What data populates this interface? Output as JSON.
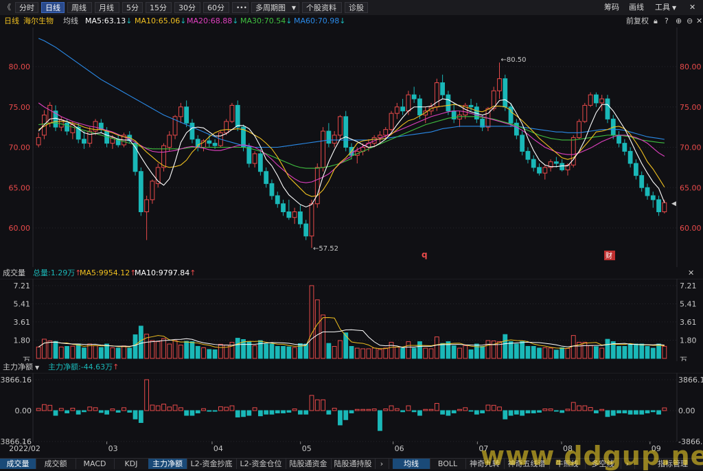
{
  "toolbar": {
    "back": "《",
    "periods": [
      "分时",
      "日线",
      "周线",
      "月线",
      "5分",
      "15分",
      "30分",
      "60分"
    ],
    "active_period": "日线",
    "more": "•••",
    "multi": "多周期图",
    "profile": "个股资料",
    "diagnose": "诊股",
    "chips": "筹码",
    "draw": "画线",
    "tools": "工具",
    "close": "✕"
  },
  "info": {
    "period": "日线",
    "stock": "海尔生物",
    "ma_label": "均线",
    "ma5": "MA5:63.13",
    "ma10": "MA10:65.06",
    "ma20": "MA20:68.88",
    "ma30": "MA30:70.54",
    "ma60": "MA60:70.98",
    "adjust": "前复权"
  },
  "colors": {
    "up": "#e84a4a",
    "down": "#1ab8b8",
    "ma5": "#ffffff",
    "ma10": "#f0c020",
    "ma20": "#e040c0",
    "ma30": "#40c040",
    "ma60": "#2a8ae8"
  },
  "price_axis": {
    "ticks": [
      "80.00",
      "75.00",
      "70.00",
      "65.00",
      "60.00"
    ]
  },
  "annotations": {
    "high": "80.50",
    "low": "57.52",
    "marker_q": "q",
    "marker_cai": "财"
  },
  "volume": {
    "title": "成交量",
    "total": "总量:1.29万",
    "ma5": "MA5:9954.12",
    "ma10": "MA10:9797.84",
    "ticks": [
      "7.21",
      "5.41",
      "3.61",
      "1.80",
      "万"
    ]
  },
  "fund": {
    "title": "主力净额",
    "value": "主力净额:-44.63万",
    "ticks": [
      "3866.16",
      "0.00",
      "-3866.16"
    ]
  },
  "date_axis": [
    "2022/02",
    "03",
    "04",
    "05",
    "06",
    "07",
    "08",
    "09"
  ],
  "bottom_tabs_left": [
    "成交量",
    "成交额",
    "MACD",
    "KDJ",
    "主力净额",
    "L2-资金抄底",
    "L2-资金仓位",
    "陆股通资金",
    "陆股通持股"
  ],
  "bottom_tabs_right": [
    "均线",
    "BOLL",
    "神奇九转",
    "神奇五线谱",
    "牛熊线",
    "多空线"
  ],
  "bottom_more": "指标管理",
  "watermark": "www.ddgup.net",
  "chart_data": {
    "type": "candlestick",
    "ylim": [
      56,
      84
    ],
    "candles": [
      [
        70.3,
        71.8,
        70.0,
        71.2
      ],
      [
        71.5,
        74.6,
        71.0,
        74.0
      ],
      [
        73.0,
        75.6,
        72.5,
        75.2
      ],
      [
        74.5,
        75.2,
        72.0,
        72.5
      ],
      [
        72.5,
        73.8,
        72.0,
        73.4
      ],
      [
        73.0,
        73.5,
        71.5,
        72.0
      ],
      [
        71.8,
        73.2,
        71.0,
        72.8
      ],
      [
        72.5,
        73.0,
        70.5,
        71.0
      ],
      [
        71.0,
        72.0,
        69.8,
        70.5
      ],
      [
        70.5,
        72.5,
        70.0,
        72.0
      ],
      [
        72.0,
        73.5,
        71.5,
        73.2
      ],
      [
        73.0,
        73.5,
        71.8,
        72.2
      ],
      [
        72.0,
        72.5,
        70.0,
        70.5
      ],
      [
        70.5,
        71.5,
        69.8,
        71.2
      ],
      [
        71.0,
        71.5,
        70.0,
        70.3
      ],
      [
        70.3,
        71.8,
        70.0,
        71.5
      ],
      [
        71.5,
        72.0,
        70.5,
        70.8
      ],
      [
        70.5,
        70.8,
        66.5,
        67.0
      ],
      [
        67.0,
        67.5,
        61.5,
        62.0
      ],
      [
        62.0,
        64.0,
        58.5,
        63.5
      ],
      [
        63.5,
        66.0,
        63.0,
        65.8
      ],
      [
        65.5,
        68.0,
        65.0,
        67.5
      ],
      [
        67.5,
        70.5,
        67.0,
        70.2
      ],
      [
        70.0,
        72.0,
        69.5,
        71.5
      ],
      [
        71.5,
        74.0,
        71.0,
        73.8
      ],
      [
        73.8,
        75.5,
        73.0,
        75.0
      ],
      [
        75.0,
        75.8,
        72.5,
        73.0
      ],
      [
        73.0,
        73.5,
        70.5,
        71.0
      ],
      [
        71.0,
        71.5,
        69.5,
        70.0
      ],
      [
        70.0,
        71.0,
        69.5,
        70.8
      ],
      [
        70.8,
        71.5,
        70.0,
        70.5
      ],
      [
        70.5,
        71.0,
        69.8,
        70.2
      ],
      [
        70.2,
        72.0,
        70.0,
        71.8
      ],
      [
        71.8,
        73.5,
        71.5,
        73.2
      ],
      [
        73.2,
        75.5,
        73.0,
        75.2
      ],
      [
        75.2,
        75.8,
        72.0,
        72.5
      ],
      [
        72.5,
        72.8,
        69.5,
        70.0
      ],
      [
        70.0,
        70.5,
        67.5,
        68.0
      ],
      [
        68.0,
        69.5,
        67.5,
        69.2
      ],
      [
        69.2,
        69.8,
        66.5,
        67.0
      ],
      [
        67.0,
        67.5,
        65.0,
        65.5
      ],
      [
        65.5,
        66.0,
        63.5,
        64.0
      ],
      [
        64.0,
        64.5,
        62.5,
        63.0
      ],
      [
        63.0,
        63.5,
        61.5,
        62.0
      ],
      [
        62.0,
        63.5,
        61.0,
        61.3
      ],
      [
        61.3,
        62.5,
        60.5,
        62.0
      ],
      [
        62.0,
        62.8,
        60.0,
        60.5
      ],
      [
        60.5,
        61.0,
        58.5,
        59.0
      ],
      [
        59.0,
        63.5,
        57.52,
        63.0
      ],
      [
        63.0,
        68.0,
        62.5,
        67.5
      ],
      [
        67.5,
        72.5,
        67.0,
        72.0
      ],
      [
        72.0,
        73.0,
        70.0,
        70.5
      ],
      [
        70.5,
        72.0,
        70.0,
        71.5
      ],
      [
        71.5,
        74.0,
        71.0,
        73.8
      ],
      [
        73.8,
        74.5,
        69.5,
        70.0
      ],
      [
        70.0,
        70.5,
        68.5,
        69.0
      ],
      [
        69.0,
        70.0,
        68.0,
        69.5
      ],
      [
        69.5,
        70.5,
        69.0,
        70.0
      ],
      [
        70.0,
        71.0,
        69.5,
        70.5
      ],
      [
        70.5,
        71.5,
        70.0,
        71.2
      ],
      [
        71.2,
        72.0,
        70.5,
        71.5
      ],
      [
        71.5,
        72.5,
        71.0,
        72.2
      ],
      [
        72.2,
        74.5,
        72.0,
        74.2
      ],
      [
        74.2,
        75.5,
        73.5,
        75.0
      ],
      [
        75.0,
        76.0,
        74.0,
        74.5
      ],
      [
        74.5,
        77.0,
        74.0,
        76.5
      ],
      [
        76.5,
        77.5,
        75.5,
        76.0
      ],
      [
        76.0,
        76.5,
        73.5,
        74.0
      ],
      [
        74.0,
        75.0,
        73.0,
        74.5
      ],
      [
        74.5,
        75.5,
        74.0,
        75.0
      ],
      [
        75.0,
        78.5,
        74.5,
        78.0
      ],
      [
        78.0,
        79.0,
        76.0,
        76.5
      ],
      [
        76.5,
        77.0,
        74.0,
        74.5
      ],
      [
        74.5,
        75.5,
        73.0,
        73.5
      ],
      [
        73.5,
        74.5,
        72.5,
        74.0
      ],
      [
        74.0,
        75.5,
        73.5,
        75.2
      ],
      [
        75.2,
        76.0,
        74.5,
        75.0
      ],
      [
        75.0,
        75.5,
        73.0,
        73.5
      ],
      [
        73.5,
        74.0,
        72.0,
        72.5
      ],
      [
        72.5,
        75.0,
        72.0,
        74.8
      ],
      [
        74.8,
        77.5,
        74.5,
        77.0
      ],
      [
        77.0,
        80.5,
        76.0,
        78.5
      ],
      [
        78.5,
        79.0,
        74.5,
        75.0
      ],
      [
        75.0,
        75.5,
        72.5,
        73.0
      ],
      [
        73.0,
        73.5,
        71.0,
        71.5
      ],
      [
        71.5,
        72.0,
        69.0,
        69.5
      ],
      [
        69.5,
        70.0,
        68.0,
        68.5
      ],
      [
        68.5,
        69.0,
        67.0,
        67.5
      ],
      [
        67.5,
        68.0,
        66.5,
        66.8
      ],
      [
        66.8,
        67.8,
        66.0,
        67.5
      ],
      [
        67.5,
        68.5,
        67.0,
        68.2
      ],
      [
        68.2,
        68.8,
        67.5,
        68.0
      ],
      [
        68.0,
        68.5,
        67.0,
        67.2
      ],
      [
        67.2,
        68.0,
        66.5,
        67.8
      ],
      [
        67.8,
        71.5,
        67.5,
        71.2
      ],
      [
        71.2,
        73.5,
        71.0,
        73.2
      ],
      [
        73.2,
        75.5,
        73.0,
        75.2
      ],
      [
        75.2,
        76.8,
        75.0,
        76.5
      ],
      [
        76.5,
        76.8,
        75.0,
        75.5
      ],
      [
        75.5,
        76.5,
        74.5,
        76.0
      ],
      [
        76.0,
        76.5,
        73.0,
        73.5
      ],
      [
        73.5,
        74.0,
        71.0,
        71.5
      ],
      [
        71.5,
        72.0,
        70.0,
        70.5
      ],
      [
        70.5,
        71.0,
        69.0,
        69.5
      ],
      [
        69.5,
        70.0,
        67.5,
        68.0
      ],
      [
        68.0,
        68.5,
        66.0,
        66.5
      ],
      [
        66.5,
        67.0,
        64.5,
        65.0
      ],
      [
        65.0,
        65.5,
        63.5,
        64.0
      ],
      [
        64.0,
        64.5,
        62.5,
        63.5
      ],
      [
        63.5,
        64.0,
        61.5,
        62.0
      ],
      [
        62.0,
        63.5,
        61.8,
        63.13
      ]
    ],
    "ma_lines": {
      "ma5": [
        72.0,
        72.8,
        73.5,
        73.6,
        73.4,
        73.2,
        72.8,
        72.3,
        71.8,
        71.6,
        71.7,
        71.8,
        71.5,
        71.3,
        71.0,
        70.9,
        70.9,
        70.0,
        68.8,
        67.7,
        66.7,
        65.8,
        65.3,
        66.1,
        68.2,
        70.6,
        71.8,
        72.4,
        72.5,
        72.4,
        71.9,
        71.4,
        71.4,
        71.7,
        72.2,
        72.7,
        72.7,
        72.3,
        71.4,
        70.1,
        68.5,
        67.7,
        66.5,
        65.1,
        64.1,
        63.5,
        62.9,
        62.6,
        62.9,
        64.1,
        66.4,
        68.2,
        69.7,
        71.0,
        71.3,
        71.0,
        70.7,
        70.3,
        70.0,
        70.1,
        70.5,
        71.0,
        71.8,
        72.8,
        73.7,
        74.5,
        75.0,
        75.0,
        75.0,
        75.1,
        75.6,
        76.0,
        75.9,
        75.5,
        75.1,
        74.7,
        74.4,
        74.2,
        74.0,
        74.2,
        74.9,
        75.8,
        75.9,
        75.4,
        74.2,
        72.9,
        71.1,
        69.6,
        68.4,
        67.8,
        67.6,
        67.6,
        67.7,
        67.7,
        68.5,
        69.5,
        70.9,
        72.7,
        74.3,
        75.3,
        75.3,
        74.5,
        73.4,
        72.3,
        70.9,
        69.4,
        68.0,
        66.8,
        65.7,
        64.9,
        63.13
      ],
      "ma10": [
        72.2,
        72.6,
        73.0,
        73.2,
        73.2,
        73.2,
        73.0,
        72.8,
        72.5,
        72.3,
        72.2,
        72.2,
        72.0,
        71.8,
        71.5,
        71.3,
        71.2,
        70.8,
        70.1,
        69.4,
        68.8,
        68.2,
        67.7,
        67.5,
        67.6,
        67.8,
        68.4,
        69.4,
        70.1,
        70.3,
        70.6,
        71.3,
        71.8,
        72.1,
        72.2,
        72.2,
        72.3,
        72.2,
        71.9,
        71.5,
        71.1,
        70.5,
        69.8,
        68.8,
        67.6,
        66.3,
        65.6,
        64.9,
        64.2,
        63.9,
        64.0,
        64.7,
        65.8,
        67.3,
        68.1,
        68.7,
        69.5,
        70.5,
        70.8,
        70.9,
        71.0,
        71.0,
        71.1,
        71.6,
        72.2,
        72.8,
        73.3,
        73.5,
        73.9,
        74.3,
        74.8,
        75.0,
        75.1,
        75.2,
        75.3,
        75.2,
        75.0,
        74.8,
        74.5,
        74.4,
        74.7,
        75.1,
        75.1,
        75.0,
        74.6,
        74.4,
        73.9,
        73.3,
        72.6,
        71.9,
        71.1,
        70.5,
        69.9,
        69.3,
        68.7,
        68.5,
        68.7,
        69.4,
        70.2,
        71.0,
        71.9,
        72.0,
        72.2,
        72.5,
        72.6,
        72.3,
        71.6,
        70.6,
        69.5,
        68.2,
        67.3,
        66.2,
        65.06
      ],
      "ma20": [
        75.5,
        75.0,
        74.6,
        74.2,
        73.8,
        73.5,
        73.2,
        73.0,
        72.8,
        72.6,
        72.5,
        72.3,
        72.1,
        71.9,
        71.6,
        71.3,
        71.0,
        70.6,
        70.2,
        69.8,
        69.5,
        69.4,
        69.4,
        69.5,
        69.6,
        69.8,
        70.0,
        70.1,
        70.0,
        69.9,
        69.7,
        69.6,
        69.6,
        69.8,
        70.0,
        70.2,
        70.3,
        70.2,
        70.0,
        69.6,
        69.1,
        68.5,
        67.8,
        67.2,
        66.6,
        66.1,
        65.7,
        65.6,
        65.7,
        66.0,
        66.3,
        66.7,
        67.3,
        68.0,
        68.5,
        68.9,
        69.3,
        69.7,
        70.1,
        70.5,
        70.8,
        71.1,
        71.4,
        71.7,
        72.0,
        72.3,
        72.6,
        72.9,
        73.2,
        73.5,
        73.8,
        74.0,
        74.2,
        74.4,
        74.5,
        74.5,
        74.4,
        74.2,
        74.0,
        73.8,
        73.6,
        73.4,
        73.2,
        73.0,
        72.8,
        72.5,
        72.1,
        71.6,
        71.0,
        70.5,
        70.0,
        69.7,
        69.4,
        69.2,
        69.1,
        69.1,
        69.3,
        69.6,
        69.9,
        70.3,
        70.7,
        71.0,
        71.3,
        71.5,
        71.5,
        71.4,
        71.2,
        70.9,
        70.5,
        69.9,
        69.3,
        68.88
      ],
      "ma30": [
        72.8,
        72.9,
        73.0,
        73.0,
        72.9,
        72.7,
        72.5,
        72.3,
        72.1,
        71.9,
        71.7,
        71.5,
        71.3,
        71.1,
        70.9,
        70.7,
        70.5,
        70.3,
        70.1,
        69.9,
        69.8,
        69.8,
        69.8,
        69.8,
        69.8,
        69.8,
        69.9,
        70.0,
        70.0,
        70.0,
        70.0,
        70.0,
        70.0,
        70.0,
        70.0,
        70.0,
        70.0,
        69.9,
        69.7,
        69.5,
        69.2,
        68.9,
        68.6,
        68.3,
        68.0,
        67.7,
        67.5,
        67.4,
        67.4,
        67.4,
        67.5,
        67.6,
        67.8,
        68.0,
        68.3,
        68.6,
        68.9,
        69.2,
        69.5,
        69.8,
        70.1,
        70.4,
        70.7,
        71.0,
        71.3,
        71.6,
        71.9,
        72.2,
        72.5,
        72.8,
        73.0,
        73.2,
        73.4,
        73.6,
        73.7,
        73.8,
        73.8,
        73.8,
        73.8,
        73.7,
        73.6,
        73.5,
        73.3,
        73.1,
        72.9,
        72.7,
        72.4,
        72.1,
        71.8,
        71.5,
        71.3,
        71.1,
        71.0,
        70.9,
        70.9,
        70.9,
        71.0,
        71.1,
        71.2,
        71.3,
        71.4,
        71.5,
        71.5,
        71.5,
        71.4,
        71.3,
        71.1,
        70.9,
        70.8,
        70.7,
        70.6,
        70.54
      ],
      "ma60": [
        83.5,
        83.2,
        82.8,
        82.4,
        81.9,
        81.4,
        80.9,
        80.4,
        79.9,
        79.4,
        78.9,
        78.4,
        78.0,
        77.6,
        77.2,
        76.8,
        76.4,
        76.0,
        75.6,
        75.2,
        74.8,
        74.4,
        74.0,
        73.7,
        73.4,
        73.1,
        72.8,
        72.5,
        72.2,
        71.9,
        71.6,
        71.3,
        71.0,
        70.8,
        70.6,
        70.4,
        70.2,
        70.1,
        70.0,
        70.0,
        70.0,
        70.0,
        70.0,
        70.1,
        70.2,
        70.3,
        70.4,
        70.5,
        70.6,
        70.7,
        70.8,
        70.9,
        70.9,
        70.9,
        70.9,
        70.9,
        70.9,
        70.9,
        70.9,
        70.9,
        71.0,
        71.0,
        71.1,
        71.2,
        71.3,
        71.4,
        71.5,
        71.6,
        71.7,
        71.8,
        71.9,
        72.1,
        72.3,
        72.4,
        72.5,
        72.6,
        72.6,
        72.6,
        72.6,
        72.6,
        72.6,
        72.6,
        72.6,
        72.6,
        72.6,
        72.6,
        72.5,
        72.4,
        72.3,
        72.2,
        72.1,
        72.0,
        71.9,
        71.9,
        71.8,
        71.8,
        71.8,
        71.9,
        72.0,
        72.1,
        72.2,
        72.2,
        72.2,
        72.2,
        72.1,
        71.9,
        71.7,
        71.5,
        71.3,
        71.2,
        71.1,
        70.98
      ]
    }
  }
}
